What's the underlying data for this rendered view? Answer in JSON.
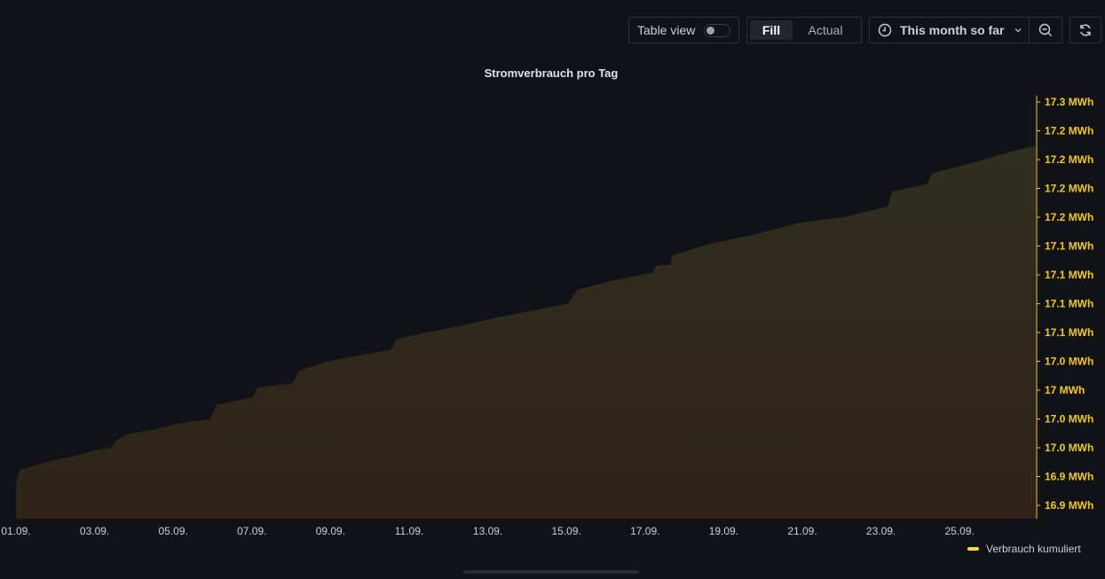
{
  "toolbar": {
    "table_view_label": "Table view",
    "table_view_on": false,
    "fill_label": "Fill",
    "actual_label": "Actual",
    "time_range_label": "This month so far",
    "icons": [
      "clock-icon",
      "chevron-down-icon",
      "zoom-out-icon",
      "refresh-icon"
    ]
  },
  "colors": {
    "axis": "#f2cc0c",
    "fill_top": "#2f2f1f",
    "fill_bottom": "#2f2318",
    "legend": "#fade2a"
  },
  "chart_data": {
    "type": "area",
    "title": "Stromverbrauch pro Tag",
    "xlabel": "",
    "ylabel": "",
    "y_unit": "MWh",
    "ylim": [
      16.9,
      17.25
    ],
    "y_ticks": [
      16.9,
      16.925,
      16.95,
      16.975,
      17.0,
      17.025,
      17.05,
      17.075,
      17.1,
      17.125,
      17.15,
      17.175,
      17.2,
      17.225,
      17.25
    ],
    "y_tick_labels": [
      "16.9 MWh",
      "16.9 MWh",
      "17.0 MWh",
      "17.0 MWh",
      "17 MWh",
      "17.0 MWh",
      "17.1 MWh",
      "17.1 MWh",
      "17.1 MWh",
      "17.1 MWh",
      "17.2 MWh",
      "17.2 MWh",
      "17.2 MWh",
      "17.2 MWh",
      "17.3 MWh"
    ],
    "x_tick_days": [
      0,
      2,
      4,
      6,
      8,
      10,
      12,
      14,
      16,
      18,
      20,
      22,
      24
    ],
    "x_tick_labels": [
      "01.09.",
      "03.09.",
      "05.09.",
      "07.09.",
      "09.09.",
      "11.09.",
      "13.09.",
      "15.09.",
      "17.09.",
      "19.09.",
      "21.09.",
      "23.09.",
      "25.09."
    ],
    "legend": "top-right-bottom",
    "series": [
      {
        "name": "Verbrauch kumuliert",
        "days": [
          0,
          0.09,
          0.95,
          1.63,
          2.01,
          2.42,
          2.53,
          2.87,
          3.54,
          4.11,
          4.94,
          5.1,
          6.03,
          6.14,
          7.04,
          7.2,
          7.95,
          8.85,
          9.53,
          9.68,
          10.43,
          11.33,
          12.23,
          13.14,
          14.04,
          14.27,
          15.17,
          16.19,
          16.3,
          16.64,
          16.7,
          17.65,
          18.78,
          19.91,
          21.04,
          22.17,
          22.28,
          23.18,
          23.3,
          24.42,
          25.1,
          25.94
        ],
        "values": [
          16.919,
          16.931,
          16.939,
          16.944,
          16.948,
          16.95,
          16.956,
          16.962,
          16.966,
          16.971,
          16.975,
          16.987,
          16.994,
          17.002,
          17.006,
          17.017,
          17.025,
          17.031,
          17.035,
          17.044,
          17.05,
          17.056,
          17.063,
          17.069,
          17.075,
          17.087,
          17.095,
          17.102,
          17.108,
          17.109,
          17.117,
          17.127,
          17.135,
          17.145,
          17.15,
          17.159,
          17.172,
          17.179,
          17.188,
          17.198,
          17.205,
          17.212
        ]
      }
    ]
  }
}
